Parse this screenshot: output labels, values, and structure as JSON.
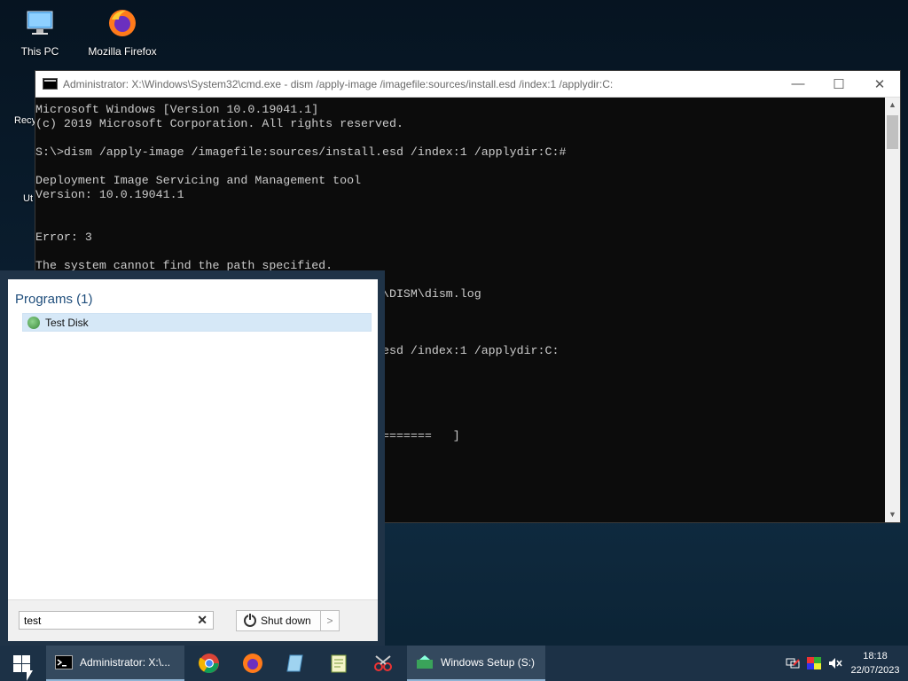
{
  "desktop": {
    "icons": [
      {
        "label": "This PC",
        "icon": "this-pc-icon"
      },
      {
        "label": "Mozilla Firefox",
        "icon": "firefox-icon"
      }
    ],
    "partial_labels": [
      "Recy",
      "Ut"
    ]
  },
  "cmd_window": {
    "title": "Administrator: X:\\Windows\\System32\\cmd.exe - dism  /apply-image /imagefile:sources/install.esd /index:1 /applydir:C:",
    "minimize": "—",
    "maximize": "☐",
    "close": "✕",
    "lines": [
      "Microsoft Windows [Version 10.0.19041.1]",
      "(c) 2019 Microsoft Corporation. All rights reserved.",
      "",
      "S:\\>dism /apply-image /imagefile:sources/install.esd /index:1 /applydir:C:#",
      "",
      "Deployment Image Servicing and Management tool",
      "Version: 10.0.19041.1",
      "",
      "",
      "Error: 3",
      "",
      "The system cannot find the path specified.",
      "",
      "                                                 \\DISM\\dism.log",
      "",
      "",
      "",
      "                                                 esd /index:1 /applydir:C:",
      "",
      "",
      "",
      "",
      "",
      "                                                 =======   ]"
    ]
  },
  "start_menu": {
    "heading": "Programs (1)",
    "results": [
      {
        "label": "Test Disk",
        "icon": "testdisk-icon"
      }
    ],
    "search_value": "test",
    "clear_symbol": "✕",
    "shutdown_label": "Shut down",
    "shutdown_arrow": ">"
  },
  "taskbar": {
    "tasks": [
      {
        "label": "Administrator: X:\\...",
        "icon": "cmd-icon"
      },
      {
        "label": "Windows Setup (S:)",
        "icon": "setup-icon"
      }
    ],
    "pinned": [
      "chrome-icon",
      "firefox-icon",
      "notepad-icon",
      "notepadpp-icon",
      "snipping-icon"
    ],
    "tray_icons": [
      "network-icon",
      "color-icon",
      "volume-muted-icon"
    ],
    "time": "18:18",
    "date": "22/07/2023"
  }
}
